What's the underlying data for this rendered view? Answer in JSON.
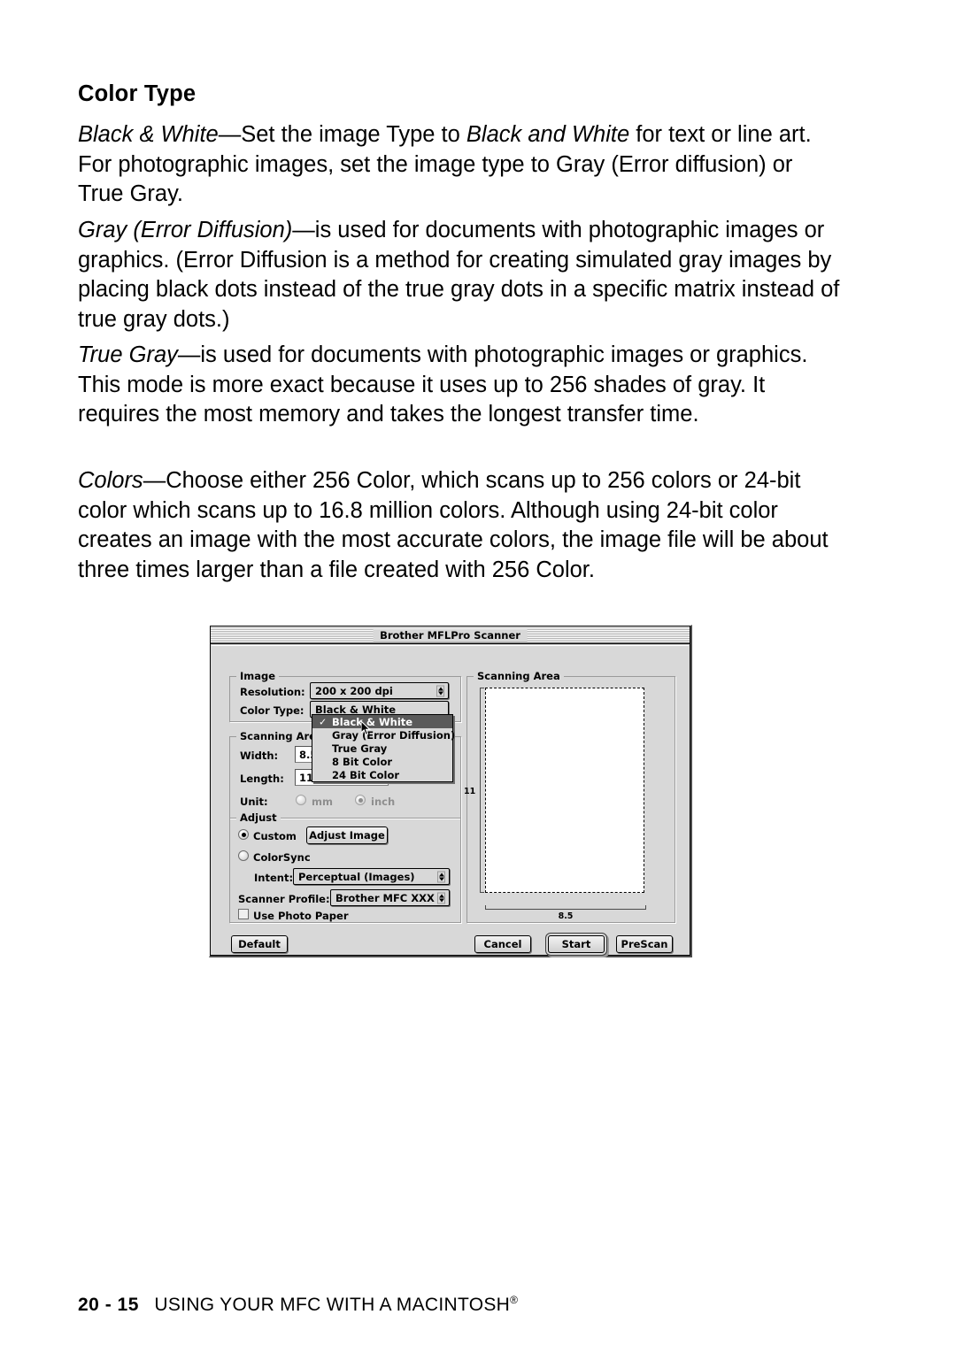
{
  "document": {
    "heading": "Color Type",
    "paragraphs": [
      {
        "id": "para1",
        "segments": [
          {
            "text": "Black & White",
            "italic": true
          },
          {
            "text": "—Set the image Type to ",
            "italic": false
          },
          {
            "text": "Black and White",
            "italic": true
          },
          {
            "text": " for text or line art. For photographic images, set the image type to Gray (Error diffusion) or True Gray.",
            "italic": false
          }
        ]
      },
      {
        "id": "para2",
        "segments": [
          {
            "text": "Gray (Error Diffusion)",
            "italic": true
          },
          {
            "text": "—is used for documents with photographic images or graphics. (Error Diffusion is a method for creating simulated gray images by placing black dots instead of the true gray dots in a specific matrix instead of true gray dots.)",
            "italic": false
          }
        ]
      },
      {
        "id": "para3",
        "segments": [
          {
            "text": "True Gray",
            "italic": true
          },
          {
            "text": "—is used for documents with photographic images or graphics. This mode is more exact because it uses up to 256 shades of gray. It requires the most memory and takes the longest transfer time.",
            "italic": false
          }
        ]
      },
      {
        "id": "para4",
        "segments": [
          {
            "text": "Colors",
            "italic": true
          },
          {
            "text": "—Choose either 256 Color, which scans up to 256 colors or 24-bit color which scans up to 16.8 million colors. Although using 24-bit color creates an image with the most accurate colors, the image file will be about three times larger than a file created with 256 Color.",
            "italic": false
          }
        ]
      }
    ],
    "footer": {
      "page_number": "20 - 15",
      "title": "USING YOUR MFC WITH A MACINTOSH",
      "trademark": "®"
    }
  },
  "dialog": {
    "title": "Brother MFLPro Scanner",
    "groups": {
      "image": {
        "label": "Image",
        "resolution_label": "Resolution:",
        "resolution_value": "200 x 200 dpi",
        "color_type_label": "Color Type:",
        "color_type_value": "Black & White"
      },
      "scanning_area": {
        "label": "Scanning Area",
        "width_label": "Width:",
        "width_value": "8.5",
        "length_label": "Length:",
        "length_value": "11",
        "unit_label": "Unit:",
        "unit_mm": "mm",
        "unit_inch": "inch",
        "unit_selected": "inch"
      },
      "adjust": {
        "label": "Adjust",
        "custom_label": "Custom",
        "adjust_image_button": "Adjust Image",
        "colorsync_label": "ColorSync",
        "intent_label": "Intent:",
        "intent_value": "Perceptual (Images)",
        "scanner_profile_label": "Scanner Profile:",
        "scanner_profile_value": "Brother MFC XXX",
        "use_photo_paper_label": "Use Photo Paper",
        "selected_mode": "Custom"
      },
      "preview": {
        "label": "Scanning Area",
        "height_dim": "11",
        "width_dim": "8.5"
      }
    },
    "color_type_menu": {
      "open": true,
      "checked": "Black & White",
      "items": [
        {
          "label": "Black & White",
          "checked": true,
          "highlighted": true
        },
        {
          "label": "Gray (Error Diffusion)",
          "checked": false,
          "highlighted": false
        },
        {
          "label": "True Gray",
          "checked": false,
          "highlighted": false
        },
        {
          "label": "8 Bit Color",
          "checked": false,
          "highlighted": false
        },
        {
          "label": "24 Bit Color",
          "checked": false,
          "highlighted": false
        }
      ],
      "check_glyph": "✓"
    },
    "buttons": {
      "default": "Default",
      "cancel": "Cancel",
      "start": "Start",
      "prescan": "PreScan"
    },
    "colors": {
      "window_bg": "#d8d8d8",
      "menu_highlight": "#5a5a5a",
      "border": "#000000"
    }
  }
}
